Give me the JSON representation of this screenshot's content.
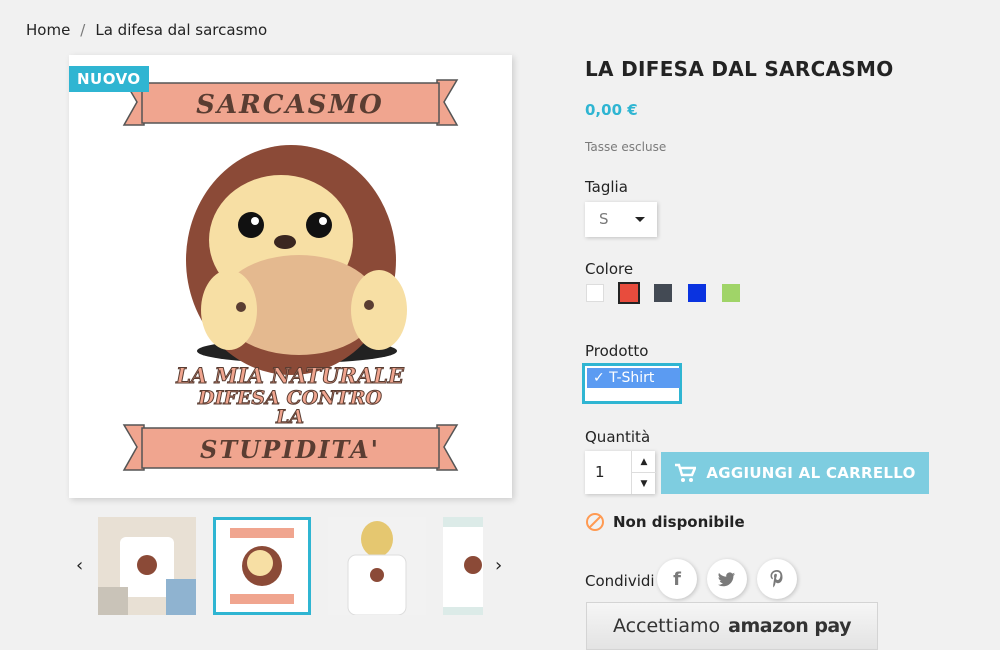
{
  "breadcrumb": {
    "home": "Home",
    "separator": "/",
    "current": "La difesa dal sarcasmo"
  },
  "badge": "NUOVO",
  "image_text": {
    "banner_top": "SARCASMO",
    "middle_1": "LA MIA NATURALE",
    "middle_2": "DIFESA CONTRO",
    "middle_3": "LA",
    "banner_bottom": "STUPIDITA'"
  },
  "product": {
    "title": "LA DIFESA DAL SARCASMO",
    "price": "0,00 €",
    "tax_note": "Tasse escluse",
    "size_label": "Taglia",
    "size_value": "S",
    "color_label": "Colore",
    "colors": [
      "#ffffff",
      "#e84c3d",
      "#434a54",
      "#0a33e0",
      "#a0d468"
    ],
    "product_label": "Prodotto",
    "product_value": "✓ T-Shirt",
    "qty_label": "Quantità",
    "qty_value": "1",
    "add_to_cart": "AGGIUNGI AL CARRELLO",
    "availability": "Non disponibile",
    "share_label": "Condividi"
  },
  "amazon": {
    "text": "Accettiamo",
    "brand": "amazon pay"
  },
  "accent": "#2fb5d2"
}
